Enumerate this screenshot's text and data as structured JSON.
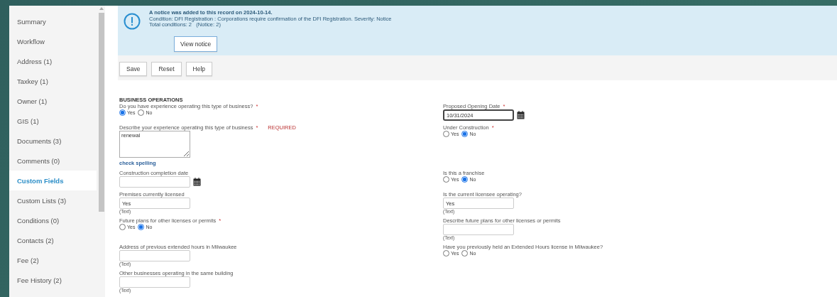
{
  "sidebar": {
    "items": [
      {
        "label": "Summary",
        "selected": false
      },
      {
        "label": "Workflow",
        "selected": false
      },
      {
        "label": "Address (1)",
        "selected": false
      },
      {
        "label": "Taxkey (1)",
        "selected": false
      },
      {
        "label": "Owner (1)",
        "selected": false
      },
      {
        "label": "GIS (1)",
        "selected": false
      },
      {
        "label": "Documents (3)",
        "selected": false
      },
      {
        "label": "Comments (0)",
        "selected": false
      },
      {
        "label": "Custom Fields",
        "selected": true
      },
      {
        "label": "Custom Lists (3)",
        "selected": false
      },
      {
        "label": "Conditions (0)",
        "selected": false
      },
      {
        "label": "Contacts (2)",
        "selected": false
      },
      {
        "label": "Fee (2)",
        "selected": false
      },
      {
        "label": "Fee History (2)",
        "selected": false
      }
    ]
  },
  "notice": {
    "title": "A notice was added to this record on 2024-10-14.",
    "lines": [
      "Condition: DFI Registration : Corporations require confirmation of the DFI Registration. Severity: Notice",
      "Total conditions: 2   (Notice: 2)"
    ],
    "button": "View notice"
  },
  "toolbar": {
    "buttons": [
      "Save",
      "Reset",
      "Help"
    ]
  },
  "section": {
    "title": "BUSINESS OPERATIONS"
  },
  "rows": [
    {
      "left": {
        "kind": "radio",
        "label": "Do you have experience operating this type of business?",
        "required_mark": "*",
        "options": [
          {
            "label": "Yes",
            "selected": true
          },
          {
            "label": "No",
            "selected": false
          }
        ]
      },
      "right": {
        "kind": "date",
        "label": "Proposed Opening Date",
        "required_mark": "*",
        "value": "10/31/2024",
        "focused": true
      }
    },
    {
      "left": {
        "kind": "textarea",
        "label": "Describe your experience operating this type of business",
        "required_mark": "*",
        "flag": "REQUIRED",
        "value": "renewal",
        "link": "check spelling"
      },
      "right": {
        "kind": "radio",
        "label": "Under Construction",
        "required_mark": "*",
        "options": [
          {
            "label": "Yes",
            "selected": false
          },
          {
            "label": "No",
            "selected": true
          }
        ]
      }
    },
    {
      "left": {
        "kind": "date",
        "label": "Construction completion date",
        "focused": false
      },
      "right": {
        "kind": "radio",
        "label": "Is this a franchise",
        "options": [
          {
            "label": "Yes",
            "selected": false
          },
          {
            "label": "No",
            "selected": true
          }
        ]
      }
    },
    {
      "left": {
        "kind": "text",
        "label": "Premises currently licensed",
        "value": "Yes",
        "hint": "(Text)"
      },
      "right": {
        "kind": "text",
        "label": "Is the current licensee operating?",
        "value": "Yes",
        "hint": "(Text)"
      }
    },
    {
      "left": {
        "kind": "radio",
        "label": "Future plans for other licenses or permits",
        "required_mark": "*",
        "options": [
          {
            "label": "Yes",
            "selected": false
          },
          {
            "label": "No",
            "selected": true
          }
        ]
      },
      "right": {
        "kind": "text",
        "label": "Describe future plans for other licenses or permits",
        "hint": "(Text)"
      }
    },
    {
      "left": {
        "kind": "text",
        "label": "Address of previous extended hours in Milwaukee",
        "hint": "(Text)"
      },
      "right": {
        "kind": "radio",
        "label": "Have you previously held an Extended Hours license in Milwaukee?",
        "options": [
          {
            "label": "Yes",
            "selected": false
          },
          {
            "label": "No",
            "selected": false
          }
        ]
      }
    },
    {
      "left": {
        "kind": "text",
        "label": "Other businesses operating in the same building",
        "hint": "(Text)"
      }
    }
  ]
}
